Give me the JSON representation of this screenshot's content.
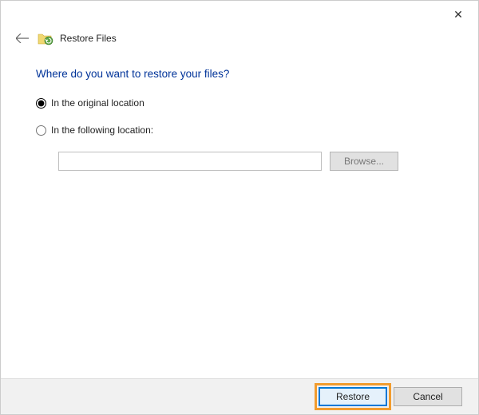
{
  "window": {
    "title": "Restore Files"
  },
  "content": {
    "heading": "Where do you want to restore your files?",
    "option_original": "In the original location",
    "option_following": "In the following location:",
    "path_value": "",
    "browse_label": "Browse..."
  },
  "footer": {
    "restore_label": "Restore",
    "cancel_label": "Cancel"
  },
  "selected_option": "original"
}
